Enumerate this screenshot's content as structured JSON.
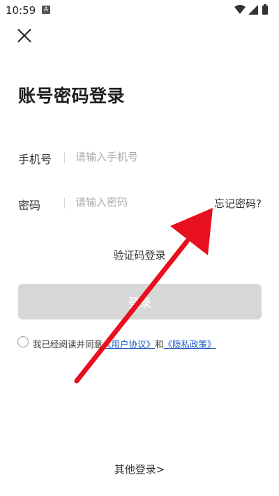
{
  "status_bar": {
    "time": "10:59",
    "notification_icon": "a-icon",
    "right_icons": [
      "wifi-icon",
      "signal-icon",
      "battery-icon"
    ]
  },
  "header": {
    "close_icon": "close-icon",
    "title": "账号密码登录"
  },
  "form": {
    "phone_label": "手机号",
    "phone_placeholder": "请输入手机号",
    "password_label": "密码",
    "password_placeholder": "请输入密码",
    "forgot_password": "忘记密码?"
  },
  "sms_login": "验证码登录",
  "login_button": "登录",
  "agreement": {
    "prefix": "我已经阅读并同意",
    "user_agreement": "《用户协议》",
    "conjunction": "和",
    "privacy_policy": "《隐私政策》"
  },
  "other_login": "其他登录>",
  "annotation": {
    "arrow_color": "#e8101e"
  },
  "colors": {
    "login_button_bg": "#d7d7d7",
    "link": "#1e5bc6",
    "title": "#1e1e1e"
  }
}
